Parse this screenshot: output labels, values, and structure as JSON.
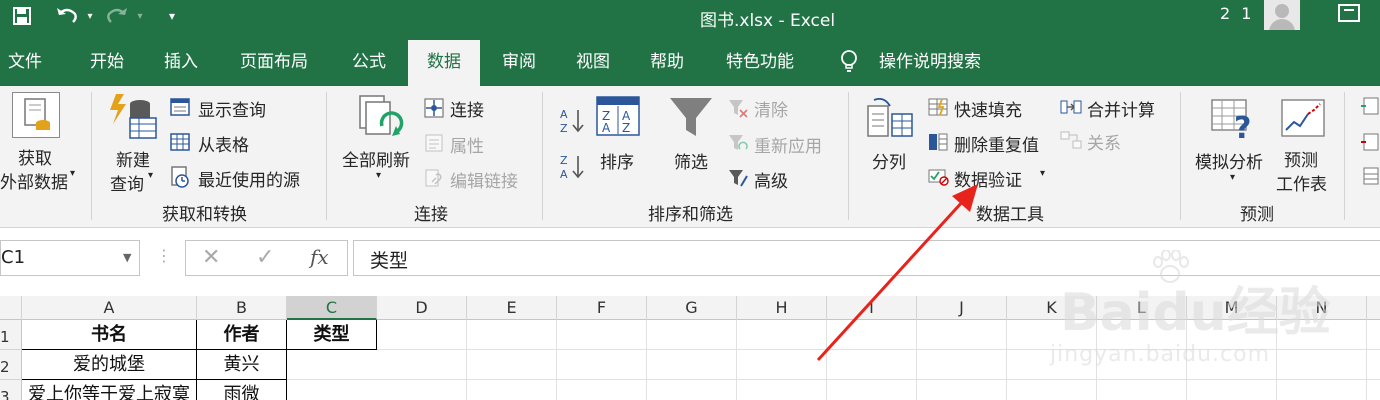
{
  "title_bar": {
    "document_title": "图书.xlsx  -  Excel",
    "user": "2 1",
    "save_icon": "save-icon",
    "undo_icon": "undo-icon",
    "redo_icon": "redo-icon",
    "customize_icon": "customize-qat-icon"
  },
  "tabs": [
    {
      "label": "文件"
    },
    {
      "label": "开始"
    },
    {
      "label": "插入"
    },
    {
      "label": "页面布局"
    },
    {
      "label": "公式"
    },
    {
      "label": "数据",
      "active": true
    },
    {
      "label": "审阅"
    },
    {
      "label": "视图"
    },
    {
      "label": "帮助"
    },
    {
      "label": "特色功能"
    }
  ],
  "tell_me": "操作说明搜索",
  "ribbon": {
    "get_transform": {
      "get_external_1": "获取",
      "get_external_2": "外部数据",
      "new_query_1": "新建",
      "new_query_2": "查询",
      "show_queries": "显示查询",
      "from_table": "从表格",
      "recent_sources": "最近使用的源",
      "group_label": "获取和转换"
    },
    "connections": {
      "refresh_all": "全部刷新",
      "connections": "连接",
      "properties": "属性",
      "edit_links": "编辑链接",
      "group_label": "连接"
    },
    "sort_filter": {
      "sort": "排序",
      "filter": "筛选",
      "clear": "清除",
      "reapply": "重新应用",
      "advanced": "高级",
      "group_label": "排序和筛选"
    },
    "data_tools": {
      "text_to_columns": "分列",
      "flash_fill": "快速填充",
      "remove_duplicates": "删除重复值",
      "data_validation": "数据验证",
      "consolidate": "合并计算",
      "relationships": "关系",
      "group_label": "数据工具"
    },
    "forecast": {
      "what_if_1": "模拟分析",
      "forecast_sheet_1": "预测",
      "forecast_sheet_2": "工作表",
      "group_label": "预测"
    }
  },
  "formula_bar": {
    "name_box": "C1",
    "fx": "fx",
    "value": "类型"
  },
  "sheet": {
    "columns": [
      "A",
      "B",
      "C",
      "D",
      "E",
      "F",
      "G",
      "H",
      "I",
      "J",
      "K",
      "L",
      "M",
      "N"
    ],
    "rows": [
      "1",
      "2",
      "3"
    ],
    "cells": {
      "A1": "书名",
      "B1": "作者",
      "C1": "类型",
      "A2": "爱的城堡",
      "B2": "黄兴",
      "A3": "爱上你等于爱上寂寞",
      "B3": "雨微"
    },
    "selected_cell": "C1"
  },
  "watermark": {
    "text": "Baidu经验",
    "url": "jingyan.baidu.com"
  },
  "colors": {
    "excel_green": "#217346",
    "annotation_red": "#e8231b"
  }
}
